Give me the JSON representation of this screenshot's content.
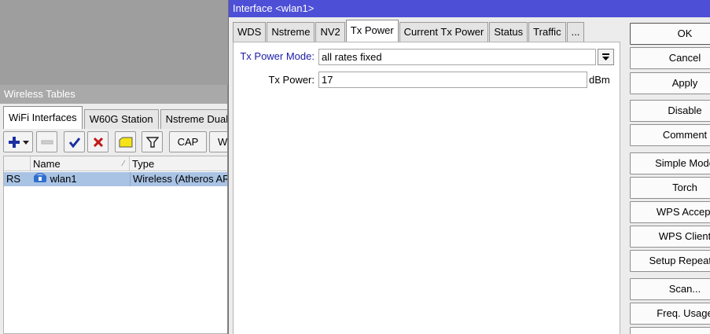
{
  "wireless_tables": {
    "title": "Wireless Tables",
    "tabs": [
      "WiFi Interfaces",
      "W60G Station",
      "Nstreme Dual"
    ],
    "toolbar": {
      "cap_label": "CAP",
      "w_label": "W"
    },
    "columns": [
      "Name",
      "Type"
    ],
    "rows": [
      {
        "flags": "RS",
        "name": "wlan1",
        "type": "Wireless (Atheros AR"
      }
    ]
  },
  "dialog": {
    "title": "Interface <wlan1>",
    "tabs": [
      "WDS",
      "Nstreme",
      "NV2",
      "Tx Power",
      "Current Tx Power",
      "Status",
      "Traffic",
      "..."
    ],
    "active_tab": "Tx Power",
    "tx_power_mode_label": "Tx Power Mode:",
    "tx_power_mode_value": "all rates fixed",
    "tx_power_label": "Tx Power:",
    "tx_power_value": "17",
    "tx_power_unit": "dBm",
    "buttons": [
      "OK",
      "Cancel",
      "Apply",
      "Disable",
      "Comment",
      "Simple Mode",
      "Torch",
      "WPS Accept",
      "WPS Client",
      "Setup Repeater",
      "Scan...",
      "Freq. Usage"
    ]
  },
  "colors": {
    "dialog_titlebar": "#4d4fd7",
    "selected_row": "#a9c3e4",
    "label_blue": "#1c1ca8"
  }
}
